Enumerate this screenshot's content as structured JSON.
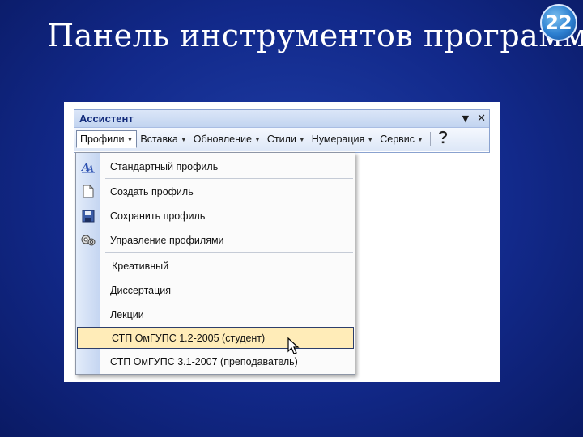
{
  "slide": {
    "title": "Панель инструментов программы",
    "number": "22"
  },
  "window": {
    "title": "Ассистент",
    "controls": {
      "dropdown": "▼",
      "close": "✕"
    }
  },
  "menubar": {
    "items": [
      {
        "label": "Профили",
        "arrow": "▼"
      },
      {
        "label": "Вставка",
        "arrow": "▼"
      },
      {
        "label": "Обновление",
        "arrow": "▼"
      },
      {
        "label": "Стили",
        "arrow": "▼"
      },
      {
        "label": "Нумерация",
        "arrow": "▼"
      },
      {
        "label": "Сервис",
        "arrow": "▼"
      }
    ],
    "help_icon": "help-pointer-icon"
  },
  "dropdown": {
    "items": [
      {
        "label": "Стандартный профиль",
        "icon": "standard-profile-icon"
      },
      {
        "label": "Создать профиль",
        "icon": "new-document-icon"
      },
      {
        "label": "Сохранить профиль",
        "icon": "save-icon"
      },
      {
        "label": "Управление профилями",
        "icon": "manage-profiles-icon"
      },
      {
        "label": "Креативный"
      },
      {
        "label": "Диссертация"
      },
      {
        "label": "Лекции"
      },
      {
        "label": "СТП ОмГУПС 1.2-2005 (студент)",
        "highlighted": true
      },
      {
        "label": "СТП ОмГУПС 3.1-2007 (преподаватель)"
      }
    ]
  },
  "colors": {
    "background": "#12298a",
    "highlight": "#ffecb8",
    "titlebar_text": "#10297a"
  }
}
